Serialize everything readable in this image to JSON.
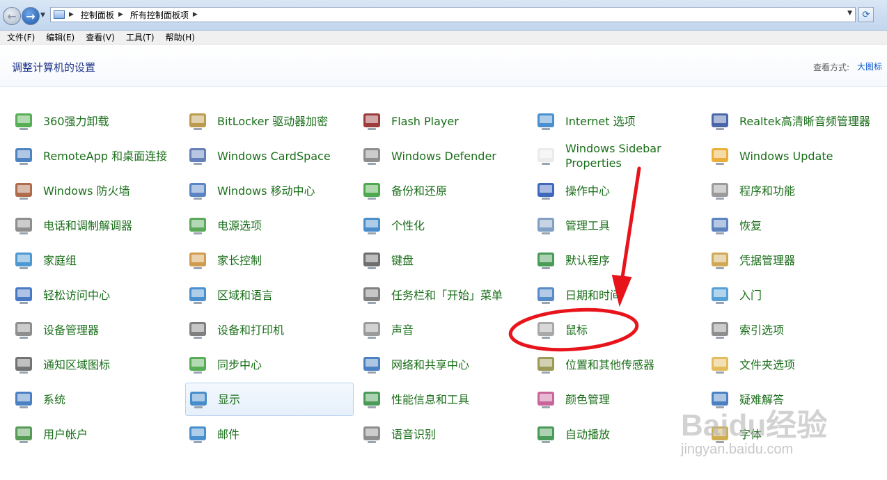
{
  "addressbar": {
    "back_glyph": "←",
    "forward_glyph": "→",
    "crumbs": [
      "控制面板",
      "所有控制面板项"
    ],
    "refresh_glyph": "⟳"
  },
  "menubar": [
    "文件(F)",
    "编辑(E)",
    "查看(V)",
    "工具(T)",
    "帮助(H)"
  ],
  "header": {
    "title": "调整计算机的设置",
    "view_by_label": "查看方式:",
    "view_mode": "大图标"
  },
  "items": [
    {
      "label": "360强力卸载",
      "icon": "uninstall-icon",
      "color": "#3aa03a"
    },
    {
      "label": "BitLocker 驱动器加密",
      "icon": "bitlocker-key-icon",
      "color": "#b08a30"
    },
    {
      "label": "Flash Player",
      "icon": "flash-icon",
      "color": "#8b1a1a"
    },
    {
      "label": "Internet 选项",
      "icon": "internet-options-icon",
      "color": "#2a7cc7"
    },
    {
      "label": "Realtek高清晰音频管理器",
      "icon": "realtek-audio-icon",
      "color": "#2a4e9a"
    },
    {
      "label": "RemoteApp 和桌面连接",
      "icon": "remoteapp-icon",
      "color": "#2f6db6"
    },
    {
      "label": "Windows CardSpace",
      "icon": "cardspace-icon",
      "color": "#4a6bb0"
    },
    {
      "label": "Windows Defender",
      "icon": "defender-icon",
      "color": "#7a7a7a"
    },
    {
      "label": "Windows Sidebar Properties",
      "icon": "sidebar-icon",
      "color": "#e8e8e8"
    },
    {
      "label": "Windows Update",
      "icon": "windows-update-icon",
      "color": "#e6a117"
    },
    {
      "label": "Windows 防火墙",
      "icon": "firewall-icon",
      "color": "#a0522d"
    },
    {
      "label": "Windows 移动中心",
      "icon": "mobility-center-icon",
      "color": "#3d6fb8"
    },
    {
      "label": "备份和还原",
      "icon": "backup-icon",
      "color": "#2f9a2f"
    },
    {
      "label": "操作中心",
      "icon": "action-center-flag-icon",
      "color": "#1f4fb3"
    },
    {
      "label": "程序和功能",
      "icon": "programs-icon",
      "color": "#8a8a8a"
    },
    {
      "label": "电话和调制解调器",
      "icon": "phone-modem-icon",
      "color": "#7a7a7a"
    },
    {
      "label": "电源选项",
      "icon": "power-options-icon",
      "color": "#3c9a3c"
    },
    {
      "label": "个性化",
      "icon": "personalization-icon",
      "color": "#2c7ac2"
    },
    {
      "label": "管理工具",
      "icon": "admin-tools-icon",
      "color": "#6b8fb8"
    },
    {
      "label": "恢复",
      "icon": "recovery-icon",
      "color": "#3f6db5"
    },
    {
      "label": "家庭组",
      "icon": "homegroup-icon",
      "color": "#2e86c9"
    },
    {
      "label": "家长控制",
      "icon": "parental-controls-icon",
      "color": "#c98a2e"
    },
    {
      "label": "键盘",
      "icon": "keyboard-icon",
      "color": "#555555"
    },
    {
      "label": "默认程序",
      "icon": "default-programs-icon",
      "color": "#2a8a3a"
    },
    {
      "label": "凭据管理器",
      "icon": "credential-manager-icon",
      "color": "#c89a3a"
    },
    {
      "label": "轻松访问中心",
      "icon": "ease-of-access-icon",
      "color": "#2a62b8"
    },
    {
      "label": "区域和语言",
      "icon": "region-language-icon",
      "color": "#2a7cc7"
    },
    {
      "label": "任务栏和「开始」菜单",
      "icon": "taskbar-icon",
      "color": "#6a6a6a"
    },
    {
      "label": "日期和时间",
      "icon": "date-time-icon",
      "color": "#3a78c0"
    },
    {
      "label": "入门",
      "icon": "getting-started-icon",
      "color": "#3a8fd0"
    },
    {
      "label": "设备管理器",
      "icon": "device-manager-icon",
      "color": "#7a7a7a"
    },
    {
      "label": "设备和打印机",
      "icon": "devices-printers-icon",
      "color": "#6a6a6a"
    },
    {
      "label": "声音",
      "icon": "sound-icon",
      "color": "#8a8a8a"
    },
    {
      "label": "鼠标",
      "icon": "mouse-icon",
      "color": "#9a9a9a"
    },
    {
      "label": "索引选项",
      "icon": "indexing-icon",
      "color": "#7a7a7a"
    },
    {
      "label": "通知区域图标",
      "icon": "notification-icons-icon",
      "color": "#5a5a5a"
    },
    {
      "label": "同步中心",
      "icon": "sync-center-icon",
      "color": "#3aa03a"
    },
    {
      "label": "网络和共享中心",
      "icon": "network-sharing-icon",
      "color": "#2c6bb8"
    },
    {
      "label": "位置和其他传感器",
      "icon": "location-sensors-icon",
      "color": "#8a8a3a"
    },
    {
      "label": "文件夹选项",
      "icon": "folder-options-icon",
      "color": "#e0b040"
    },
    {
      "label": "系统",
      "icon": "system-icon",
      "color": "#2c6bb8"
    },
    {
      "label": "显示",
      "icon": "display-icon",
      "color": "#2c7ac2",
      "selected": true
    },
    {
      "label": "性能信息和工具",
      "icon": "performance-icon",
      "color": "#2a8a3a"
    },
    {
      "label": "颜色管理",
      "icon": "color-management-icon",
      "color": "#c04a8a"
    },
    {
      "label": "疑难解答",
      "icon": "troubleshooting-icon",
      "color": "#2c6bb8"
    },
    {
      "label": "用户帐户",
      "icon": "user-accounts-icon",
      "color": "#3a8a3a"
    },
    {
      "label": "邮件",
      "icon": "mail-icon",
      "color": "#2a7cc7"
    },
    {
      "label": "语音识别",
      "icon": "speech-recognition-icon",
      "color": "#7a7a7a"
    },
    {
      "label": "自动播放",
      "icon": "autoplay-icon",
      "color": "#2a8a3a"
    },
    {
      "label": "字体",
      "icon": "fonts-icon",
      "color": "#c8a030"
    }
  ],
  "watermark": {
    "line1": "Baidu经验",
    "line2": "jingyan.baidu.com"
  },
  "annotation": {
    "color": "#e8141c"
  }
}
